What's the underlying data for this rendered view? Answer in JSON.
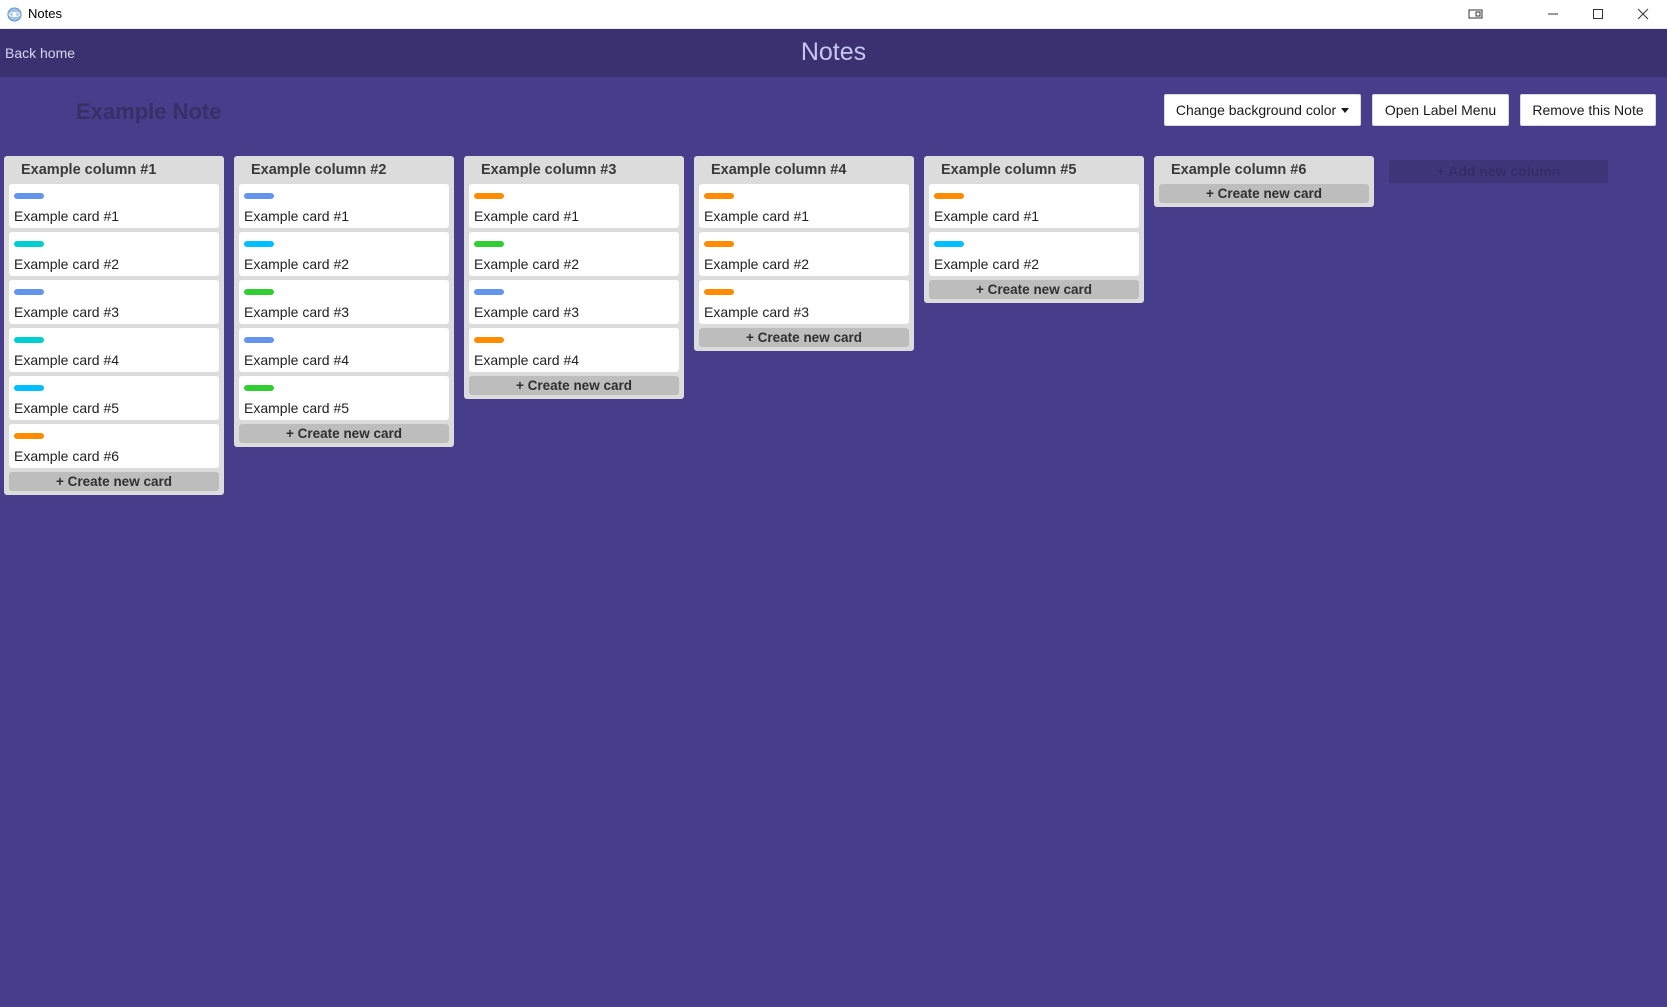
{
  "window": {
    "title": "Notes",
    "controls": [
      "mode-icon",
      "minimize-icon",
      "maximize-icon",
      "close-icon"
    ]
  },
  "header": {
    "back_label": "Back home",
    "title": "Notes"
  },
  "note": {
    "title": "Example Note"
  },
  "toolbar": {
    "bg_color_label": "Change background color",
    "label_menu_label": "Open Label Menu",
    "remove_label": "Remove this Note"
  },
  "colors": {
    "background": "#483d8b",
    "header": "#3b3170",
    "column": "#dcdcdc",
    "label_blue": "#6495ed",
    "label_turquoise": "#00ced1",
    "label_skyblue": "#00bfff",
    "label_orange": "#ff8c00",
    "label_green": "#32cd32"
  },
  "create_card_label": "+ Create new card",
  "add_column_label": "+ Add new column",
  "columns": [
    {
      "title": "Example column #1",
      "cards": [
        {
          "text": "Example card #1",
          "label_color": "#6495ed"
        },
        {
          "text": "Example card #2",
          "label_color": "#00ced1"
        },
        {
          "text": "Example card #3",
          "label_color": "#6495ed"
        },
        {
          "text": "Example card #4",
          "label_color": "#00ced1"
        },
        {
          "text": "Example card #5",
          "label_color": "#00bfff"
        },
        {
          "text": "Example card #6",
          "label_color": "#ff8c00"
        }
      ]
    },
    {
      "title": "Example column #2",
      "cards": [
        {
          "text": "Example card #1",
          "label_color": "#6495ed"
        },
        {
          "text": "Example card #2",
          "label_color": "#00bfff"
        },
        {
          "text": "Example card #3",
          "label_color": "#32cd32"
        },
        {
          "text": "Example card #4",
          "label_color": "#6495ed"
        },
        {
          "text": "Example card #5",
          "label_color": "#32cd32"
        }
      ]
    },
    {
      "title": "Example column #3",
      "cards": [
        {
          "text": "Example card #1",
          "label_color": "#ff8c00"
        },
        {
          "text": "Example card #2",
          "label_color": "#32cd32"
        },
        {
          "text": "Example card #3",
          "label_color": "#6495ed"
        },
        {
          "text": "Example card #4",
          "label_color": "#ff8c00"
        }
      ]
    },
    {
      "title": "Example column #4",
      "cards": [
        {
          "text": "Example card #1",
          "label_color": "#ff8c00"
        },
        {
          "text": "Example card #2",
          "label_color": "#ff8c00"
        },
        {
          "text": "Example card #3",
          "label_color": "#ff8c00"
        }
      ]
    },
    {
      "title": "Example column #5",
      "cards": [
        {
          "text": "Example card #1",
          "label_color": "#ff8c00"
        },
        {
          "text": "Example card #2",
          "label_color": "#00bfff"
        }
      ]
    },
    {
      "title": "Example column #6",
      "cards": []
    }
  ]
}
